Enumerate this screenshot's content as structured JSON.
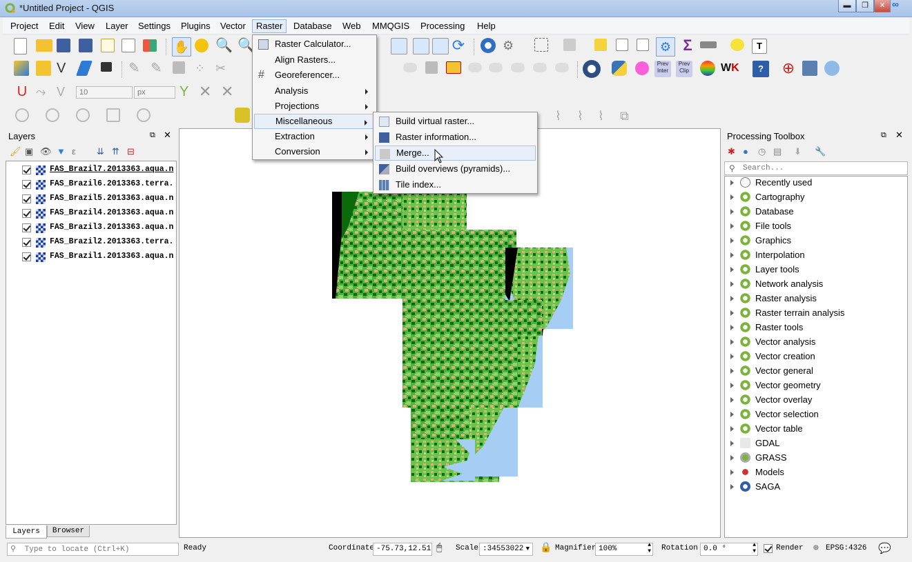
{
  "window": {
    "title": "*Untitled Project - QGIS"
  },
  "menubar": [
    "Project",
    "Edit",
    "View",
    "Layer",
    "Settings",
    "Plugins",
    "Vector",
    "Raster",
    "Database",
    "Web",
    "MMQGIS",
    "Processing",
    "Help"
  ],
  "raster_menu": {
    "items": [
      {
        "label": "Raster Calculator...",
        "submenu": false
      },
      {
        "label": "Align Rasters...",
        "submenu": false
      },
      {
        "label": "Georeferencer...",
        "submenu": false
      },
      {
        "label": "Analysis",
        "submenu": true
      },
      {
        "label": "Projections",
        "submenu": true
      },
      {
        "label": "Miscellaneous",
        "submenu": true
      },
      {
        "label": "Extraction",
        "submenu": true
      },
      {
        "label": "Conversion",
        "submenu": true
      }
    ]
  },
  "misc_submenu": {
    "items": [
      "Build virtual raster...",
      "Raster information...",
      "Merge...",
      "Build overviews (pyramids)...",
      "Tile index..."
    ],
    "highlighted": "Merge..."
  },
  "toolbar": {
    "width_value": "10",
    "unit_value": "px"
  },
  "layers_panel": {
    "title": "Layers",
    "layers": [
      "FAS_Brazil7.2013363.aqua.n",
      "FAS_Brazil6.2013363.terra.",
      "FAS_Brazil5.2013363.aqua.n",
      "FAS_Brazil4.2013363.aqua.n",
      "FAS_Brazil3.2013363.aqua.n",
      "FAS_Brazil2.2013363.terra.",
      "FAS_Brazil1.2013363.aqua.n"
    ],
    "tabs": [
      "Layers",
      "Browser"
    ]
  },
  "toolbox": {
    "title": "Processing Toolbox",
    "search_placeholder": "Search...",
    "items": [
      "Recently used",
      "Cartography",
      "Database",
      "File tools",
      "Graphics",
      "Interpolation",
      "Layer tools",
      "Network analysis",
      "Raster analysis",
      "Raster terrain analysis",
      "Raster tools",
      "Vector analysis",
      "Vector creation",
      "Vector general",
      "Vector geometry",
      "Vector overlay",
      "Vector selection",
      "Vector table",
      "GDAL",
      "GRASS",
      "Models",
      "SAGA"
    ]
  },
  "statusbar": {
    "locate_placeholder": "Type to locate (Ctrl+K)",
    "message": "Ready",
    "coordinate_label": "Coordinate",
    "coordinate": "-75.73,12.51",
    "scale_label": "Scale",
    "scale": ":34553022",
    "magnifier_label": "Magnifier",
    "magnifier": "100%",
    "rotation_label": "Rotation",
    "rotation": "0.0 °",
    "render_label": "Render",
    "crs": "EPSG:4326"
  },
  "colors": {
    "green_dark": "#0b6b0b",
    "green_mid": "#3aa336",
    "green_light": "#8fd46a",
    "tan": "#d9b27a",
    "water": "#a6cdf3"
  }
}
